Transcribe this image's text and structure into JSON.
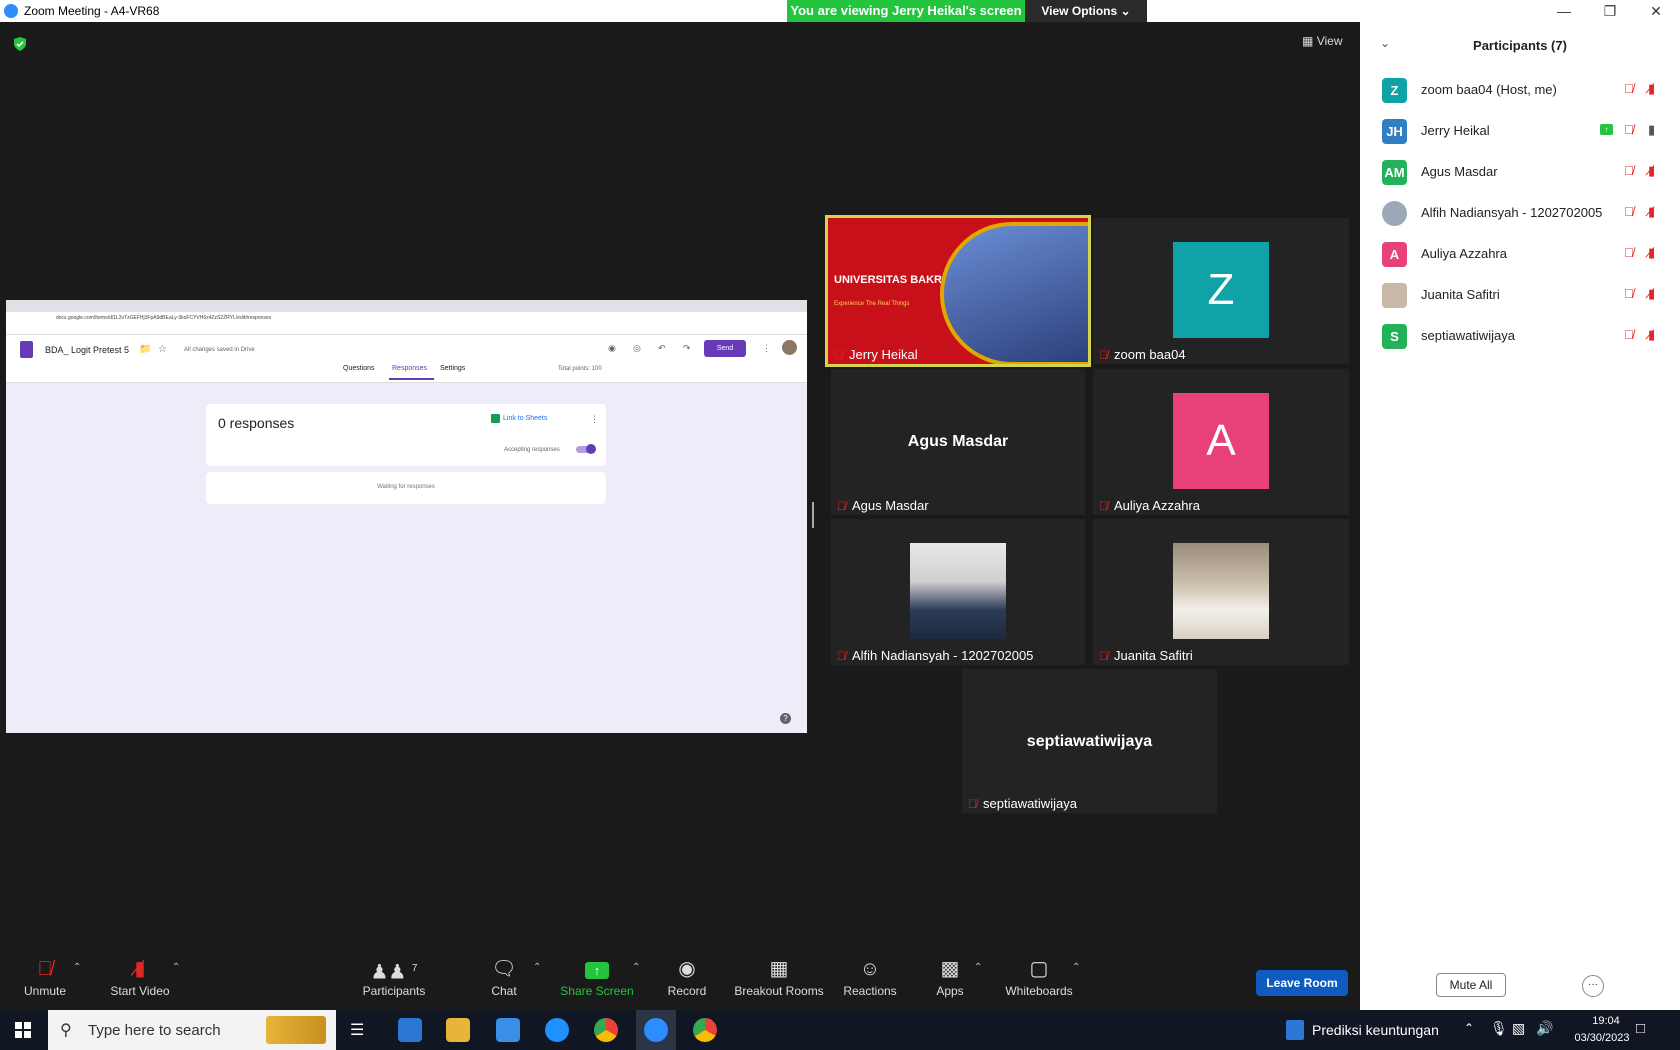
{
  "window": {
    "title": "Zoom Meeting - A4-VR68"
  },
  "banner": {
    "viewing": "You are viewing Jerry Heikal's screen",
    "view_options": "View Options"
  },
  "view_label": "View",
  "shared_screen": {
    "form_title": "BDA_ Logit Pretest 5",
    "saved_status": "All changes saved in Drive",
    "send_label": "Send",
    "tabs": [
      "Questions",
      "Responses",
      "Settings"
    ],
    "total_points": "Total points: 100",
    "responses_count": "0 responses",
    "link_to_sheets": "Link to Sheets",
    "accepting_responses": "Accepting responses",
    "waiting": "Waiting for responses",
    "url": "docs.google.com/forms/d/1L3vTzGEFHj3FpA9dBEaLy-3koFCYVH6x4ZzS2ZRYL/edit#responses"
  },
  "tiles": {
    "jerry": {
      "name": "Jerry Heikal",
      "slide_title": "UNIVERSITAS BAKRIE",
      "slide_sub": "Experience The Real Things"
    },
    "zoom": {
      "name": "zoom baa04",
      "initial": "Z"
    },
    "agus": {
      "name": "Agus Masdar"
    },
    "auliya": {
      "name": "Auliya Azzahra",
      "initial": "A"
    },
    "alfih": {
      "name": "Alfih Nadiansyah - 1202702005"
    },
    "juanita": {
      "name": "Juanita Safitri"
    },
    "septia": {
      "name": "septiawatiwijaya"
    }
  },
  "toolbar": {
    "unmute": "Unmute",
    "start_video": "Start Video",
    "participants": "Participants",
    "participants_count": "7",
    "chat": "Chat",
    "share_screen": "Share Screen",
    "record": "Record",
    "breakout_rooms": "Breakout Rooms",
    "reactions": "Reactions",
    "apps": "Apps",
    "whiteboards": "Whiteboards",
    "leave_room": "Leave Room"
  },
  "panel": {
    "title": "Participants (7)",
    "participants": [
      {
        "initials": "Z",
        "name": "zoom baa04 (Host, me)",
        "color": "#0fa3a8"
      },
      {
        "initials": "JH",
        "name": "Jerry Heikal",
        "color": "#2f7fc2"
      },
      {
        "initials": "AM",
        "name": "Agus Masdar",
        "color": "#23b25a"
      },
      {
        "initials": "",
        "name": "Alfih Nadiansyah - 1202702005",
        "color": "#9aa8b8"
      },
      {
        "initials": "A",
        "name": "Auliya Azzahra",
        "color": "#e8407a"
      },
      {
        "initials": "",
        "name": "Juanita Safitri",
        "color": "#c8b8a8"
      },
      {
        "initials": "S",
        "name": "septiawatiwijaya",
        "color": "#23b25a"
      }
    ],
    "mute_all": "Mute All",
    "more": "···"
  },
  "taskbar": {
    "search_placeholder": "Type here to search",
    "weather": "Prediksi keuntungan",
    "time": "19:04",
    "date": "03/30/2023"
  },
  "colors": {
    "zoom_blue": "#0e5cbf",
    "green": "#23c53f",
    "forms_purple": "#673ab7",
    "muted_red": "#e02828"
  }
}
